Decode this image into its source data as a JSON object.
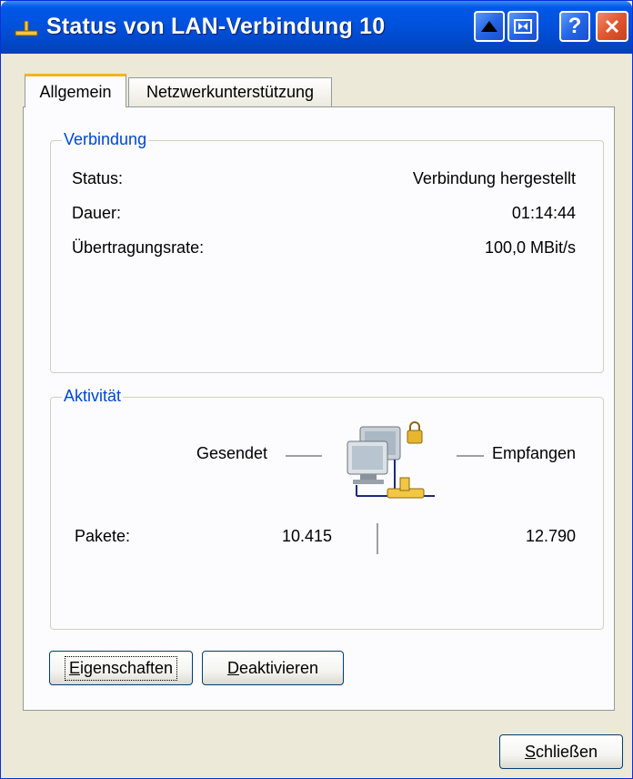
{
  "window": {
    "title": "Status von LAN-Verbindung 10",
    "title_icon": "network-connection-icon",
    "buttons": [
      "minimize",
      "maximize",
      "help",
      "close"
    ],
    "help_label": "?"
  },
  "tabs": [
    {
      "label": "Allgemein",
      "active": true
    },
    {
      "label": "Netzwerkunterstützung",
      "active": false
    }
  ],
  "verbindung": {
    "legend": "Verbindung",
    "rows": [
      {
        "label": "Status:",
        "value": "Verbindung hergestellt"
      },
      {
        "label": "Dauer:",
        "value": "01:14:44"
      },
      {
        "label": "Übertragungsrate:",
        "value": "100,0 MBit/s"
      }
    ]
  },
  "aktivitaet": {
    "legend": "Aktivität",
    "sent_label": "Gesendet",
    "received_label": "Empfangen",
    "packets_label": "Pakete:",
    "packets_sent": "10.415",
    "packets_received": "12.790",
    "icon": "network-computers-icon"
  },
  "buttons": {
    "eigenschaften": {
      "first": "E",
      "rest": "igenschaften"
    },
    "deaktivieren": {
      "first": "D",
      "rest": "eaktivieren"
    },
    "schliessen": {
      "first": "S",
      "rest": "chließen"
    }
  },
  "colors": {
    "titlebar": "#0052dc",
    "legend_text": "#0046d5",
    "active_tab_accent": "#f7b31b",
    "dialog_bg": "#ece9d8"
  }
}
